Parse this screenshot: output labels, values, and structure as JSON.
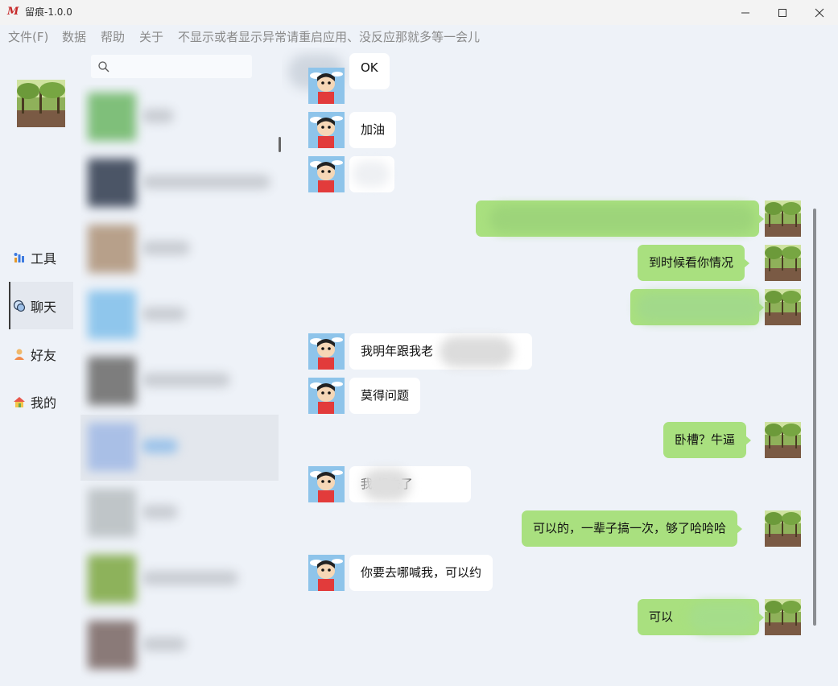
{
  "window": {
    "app_logo": "M",
    "title": "留痕-1.0.0"
  },
  "menu": {
    "items": [
      "文件(F)",
      "数据",
      "帮助",
      "关于",
      "不显示或者显示异常请重启应用、没反应那就多等一会儿"
    ]
  },
  "nav": {
    "items": [
      {
        "label": "工具",
        "icon": "tools-icon"
      },
      {
        "label": "聊天",
        "icon": "chat-icon"
      },
      {
        "label": "好友",
        "icon": "friend-icon"
      },
      {
        "label": "我的",
        "icon": "home-icon"
      }
    ],
    "active": "聊天"
  },
  "search": {
    "placeholder": "",
    "value": ""
  },
  "messages": [
    {
      "side": "left",
      "text": "OK"
    },
    {
      "side": "left",
      "text": "加油"
    },
    {
      "side": "left",
      "text": ""
    },
    {
      "side": "right",
      "text": ""
    },
    {
      "side": "right",
      "text": "到时候看你情况"
    },
    {
      "side": "right",
      "text": ""
    },
    {
      "side": "left",
      "text": "我明年跟我老"
    },
    {
      "side": "left",
      "text": "莫得问题"
    },
    {
      "side": "right",
      "text": "卧槽？牛逼"
    },
    {
      "side": "left",
      "text": "我 想去了"
    },
    {
      "side": "right",
      "text": "可以的，一辈子搞一次，够了哈哈哈"
    },
    {
      "side": "left",
      "text": "你要去哪喊我，可以约"
    },
    {
      "side": "right",
      "text": "可以"
    }
  ],
  "colors": {
    "background": "#eef2f8",
    "bubble_self": "#a9e07f",
    "bubble_other": "#ffffff",
    "menu_text": "#8a8a8a"
  }
}
